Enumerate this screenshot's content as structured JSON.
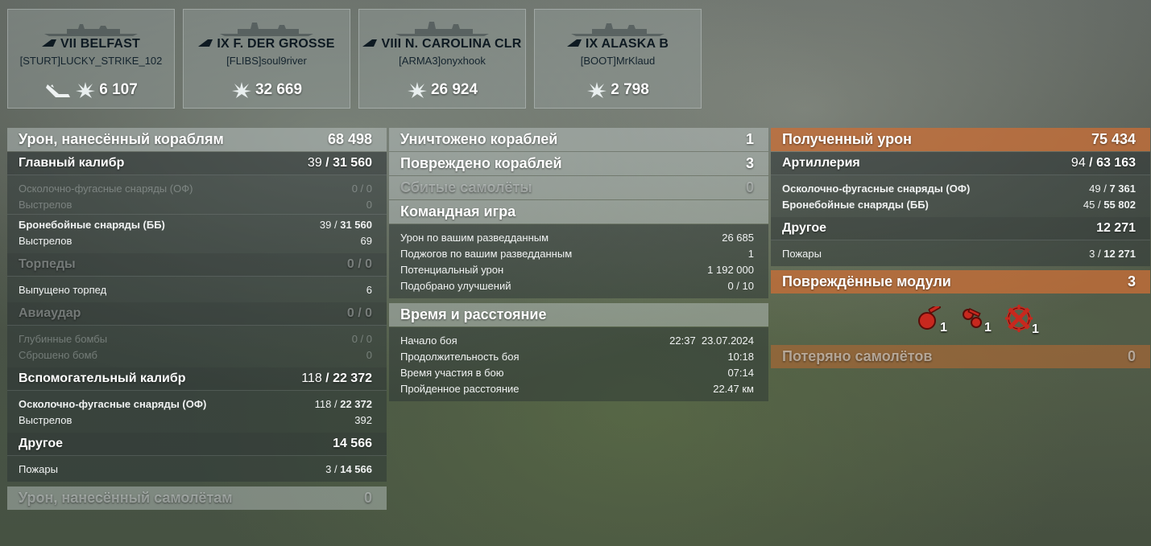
{
  "ships": [
    {
      "name": "VII BELFAST",
      "player": "[STURT]LUCKY_STRIKE_102",
      "damage": "6 107",
      "extra_icon": "torpedo-ribbon-icon"
    },
    {
      "name": "IX F. DER GROSSE",
      "player": "[FLIBS]soul9river",
      "damage": "32 669"
    },
    {
      "name": "VIII N. CAROLINA CLR",
      "player": "[ARMA3]onyxhook",
      "damage": "26 924"
    },
    {
      "name": "IX ALASKA B",
      "player": "[BOOT]MrKlaud",
      "damage": "2 798"
    }
  ],
  "col1": {
    "damage_ships": {
      "label": "Урон, нанесённый кораблям",
      "value": "68 498"
    },
    "main_battery": {
      "label": "Главный калибр",
      "hits": "39",
      "value": "31 560"
    },
    "he": {
      "label": "Осколочно-фугасные снаряды (ОФ)",
      "value": "0 / 0"
    },
    "he_shots": {
      "label": "Выстрелов",
      "value": "0"
    },
    "ap": {
      "label": "Бронебойные снаряды (ББ)",
      "hits": "39",
      "value": "31 560"
    },
    "ap_shots": {
      "label": "Выстрелов",
      "value": "69"
    },
    "torpedoes": {
      "label": "Торпеды",
      "value": "0 / 0"
    },
    "torps_launched": {
      "label": "Выпущено торпед",
      "value": "6"
    },
    "airstrike": {
      "label": "Авиаудар",
      "value": "0 / 0"
    },
    "depth": {
      "label": "Глубинные бомбы",
      "value": "0 / 0"
    },
    "bombs": {
      "label": "Сброшено бомб",
      "value": "0"
    },
    "secondary": {
      "label": "Вспомогательный калибр",
      "hits": "118",
      "value": "22 372"
    },
    "sec_he": {
      "label": "Осколочно-фугасные снаряды (ОФ)",
      "hits": "118",
      "value": "22 372"
    },
    "sec_shots": {
      "label": "Выстрелов",
      "value": "392"
    },
    "other": {
      "label": "Другое",
      "value": "14 566"
    },
    "fires": {
      "label": "Пожары",
      "hits": "3",
      "value": "14 566"
    },
    "plane_damage": {
      "label": "Урон, нанесённый самолётам",
      "value": "0"
    }
  },
  "col2": {
    "destroyed": {
      "label": "Уничтожено кораблей",
      "value": "1"
    },
    "damaged": {
      "label": "Повреждено кораблей",
      "value": "3"
    },
    "planes": {
      "label": "Сбитые самолёты",
      "value": "0"
    },
    "team": {
      "label": "Командная игра"
    },
    "spot_dmg": {
      "label": "Урон по вашим разведданным",
      "value": "26 685"
    },
    "spot_fires": {
      "label": "Поджогов по вашим разведданным",
      "value": "1"
    },
    "potential": {
      "label": "Потенциальный урон",
      "value": "1 192 000"
    },
    "upgrades": {
      "label": "Подобрано улучшений",
      "value": "0 / 10"
    },
    "time": {
      "label": "Время и расстояние"
    },
    "start": {
      "label": "Начало боя",
      "value": "22:37  23.07.2024"
    },
    "duration": {
      "label": "Продолжительность боя",
      "value": "10:18"
    },
    "participation": {
      "label": "Время участия в бою",
      "value": "07:14"
    },
    "distance": {
      "label": "Пройденное расстояние",
      "value": "22.47 км"
    }
  },
  "col3": {
    "received": {
      "label": "Полученный урон",
      "value": "75 434"
    },
    "artillery": {
      "label": "Артиллерия",
      "hits": "94",
      "value": "63 163"
    },
    "r_he": {
      "label": "Осколочно-фугасные снаряды (ОФ)",
      "hits": "49",
      "value": "7 361"
    },
    "r_ap": {
      "label": "Бронебойные снаряды (ББ)",
      "hits": "45",
      "value": "55 802"
    },
    "r_other": {
      "label": "Другое",
      "value": "12 271"
    },
    "r_fires": {
      "label": "Пожары",
      "hits": "3",
      "value": "12 271"
    },
    "modules": {
      "label": "Повреждённые модули",
      "value": "3"
    },
    "module_items": [
      {
        "icon": "turret-module-icon",
        "count": "1"
      },
      {
        "icon": "torpedo-tube-module-icon",
        "count": "1"
      },
      {
        "icon": "steering-gear-module-icon",
        "count": "1"
      }
    ],
    "lost_planes": {
      "label": "Потеряно самолётов",
      "value": "0"
    }
  }
}
